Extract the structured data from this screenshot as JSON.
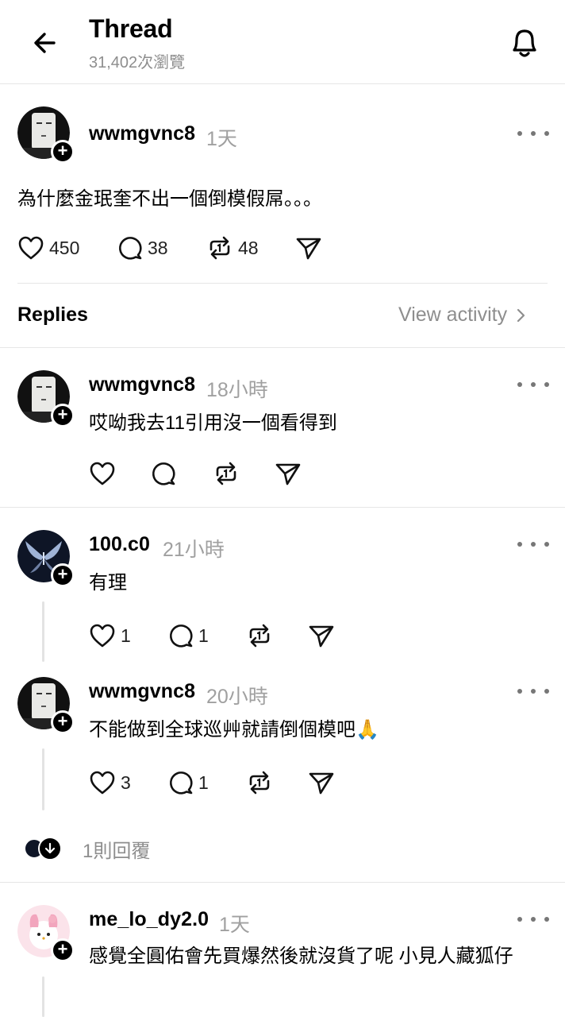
{
  "header": {
    "title": "Thread",
    "views": "31,402次瀏覽",
    "back_icon": "arrow-left-icon",
    "bell_icon": "bell-icon"
  },
  "main_post": {
    "username": "wwmgvnc8",
    "time": "1天",
    "text": "為什麼金珉奎不出一個倒模假屌。。。",
    "likes": "450",
    "comments": "38",
    "reposts": "48"
  },
  "replies_bar": {
    "label": "Replies",
    "view_activity": "View activity"
  },
  "replies": [
    {
      "username": "wwmgvnc8",
      "time": "18小時",
      "text": "哎呦我去11引用沒一個看得到",
      "likes": "",
      "comments": ""
    },
    {
      "username": "100.c0",
      "time": "21小時",
      "text": "有理",
      "likes": "1",
      "comments": "1"
    },
    {
      "username": "wwmgvnc8",
      "time": "20小時",
      "text": "不能做到全球巡艸就請倒個模吧🙏",
      "likes": "3",
      "comments": "1"
    },
    {
      "username": "me_lo_dy2.0",
      "time": "1天",
      "text": "感覺全圓佑會先買爆然後就沒貨了呢 小見人藏狐仔",
      "likes": "",
      "comments": ""
    }
  ],
  "more_replies": {
    "label": "1則回覆"
  },
  "colors": {
    "text": "#000000",
    "secondary": "#8e8e8e",
    "divider": "#e6e6e6"
  }
}
